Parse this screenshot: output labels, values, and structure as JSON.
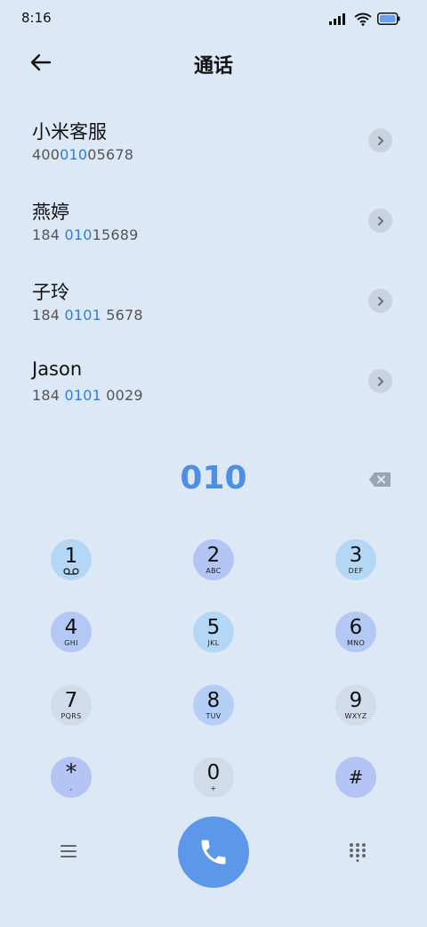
{
  "status": {
    "time": "8:16"
  },
  "header": {
    "title": "通话"
  },
  "contacts": [
    {
      "name": "小米客服",
      "number_parts": [
        "400",
        "010",
        "05678"
      ]
    },
    {
      "name": "燕婷",
      "number_parts": [
        "184 ",
        "010",
        "15689"
      ]
    },
    {
      "name": "子玲",
      "number_parts": [
        "184 ",
        "0101",
        " 5678"
      ]
    },
    {
      "name": "Jason",
      "number_parts": [
        "184 ",
        "0101",
        " 0029"
      ]
    }
  ],
  "dialer": {
    "number": "010"
  },
  "keypad": [
    {
      "digit": "1",
      "letters": ""
    },
    {
      "digit": "2",
      "letters": "ABC"
    },
    {
      "digit": "3",
      "letters": "DEF"
    },
    {
      "digit": "4",
      "letters": "GHI"
    },
    {
      "digit": "5",
      "letters": "JKL"
    },
    {
      "digit": "6",
      "letters": "MNO"
    },
    {
      "digit": "7",
      "letters": "PQRS"
    },
    {
      "digit": "8",
      "letters": "TUV"
    },
    {
      "digit": "9",
      "letters": "WXYZ"
    },
    {
      "digit": "*",
      "letters": ","
    },
    {
      "digit": "0",
      "letters": "+"
    },
    {
      "digit": "#",
      "letters": ""
    }
  ],
  "colors": {
    "background": "#dde8f7",
    "accent": "#4d8fe5",
    "highlight": "#2f7fd6",
    "call_button": "#5d97ea",
    "key_light_blue": "#b3d7f5",
    "key_lavender": "#b4c4f5",
    "key_gray": "#d0dcea"
  },
  "icons": {
    "back": "arrow-left-icon",
    "chevron": "chevron-right-icon",
    "backspace": "backspace-icon",
    "voicemail": "voicemail-icon",
    "call": "phone-icon",
    "menu": "menu-icon",
    "dialpad": "dialpad-icon"
  }
}
